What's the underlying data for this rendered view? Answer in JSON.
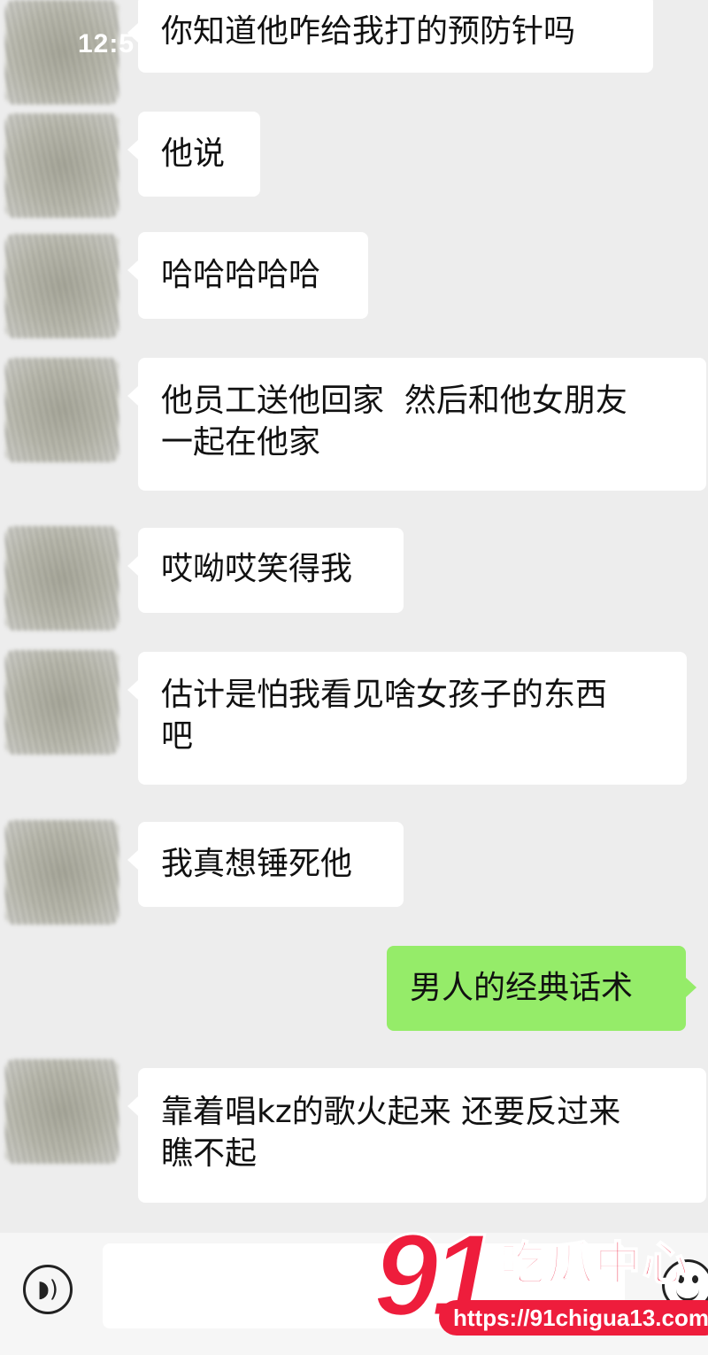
{
  "status_bar": {
    "time": "12:5"
  },
  "messages": [
    {
      "side": "left",
      "text": "你知道他咋给我打的预防针吗"
    },
    {
      "side": "left",
      "text": "他说"
    },
    {
      "side": "left",
      "text": "哈哈哈哈哈"
    },
    {
      "side": "left",
      "text": "他员工送他回家  然后和他女朋友\n一起在他家"
    },
    {
      "side": "left",
      "text": "哎呦哎笑得我"
    },
    {
      "side": "left",
      "text": "估计是怕我看见啥女孩子的东西\n吧"
    },
    {
      "side": "left",
      "text": "我真想锤死他"
    },
    {
      "side": "right",
      "text": "男人的经典话术"
    },
    {
      "side": "left",
      "text": "靠着唱kz的歌火起来 还要反过来\n瞧不起"
    }
  ],
  "input_bar": {
    "voice_icon": "voice-icon",
    "value": "",
    "emoji_icon": "emoji-icon"
  },
  "watermark": {
    "number": "91",
    "name": "吃瓜中心",
    "url": "https://91chigua13.com"
  },
  "colors": {
    "background": "#ededed",
    "incoming_bubble": "#ffffff",
    "outgoing_bubble": "#95ec69",
    "watermark": "#ee1d3c"
  }
}
